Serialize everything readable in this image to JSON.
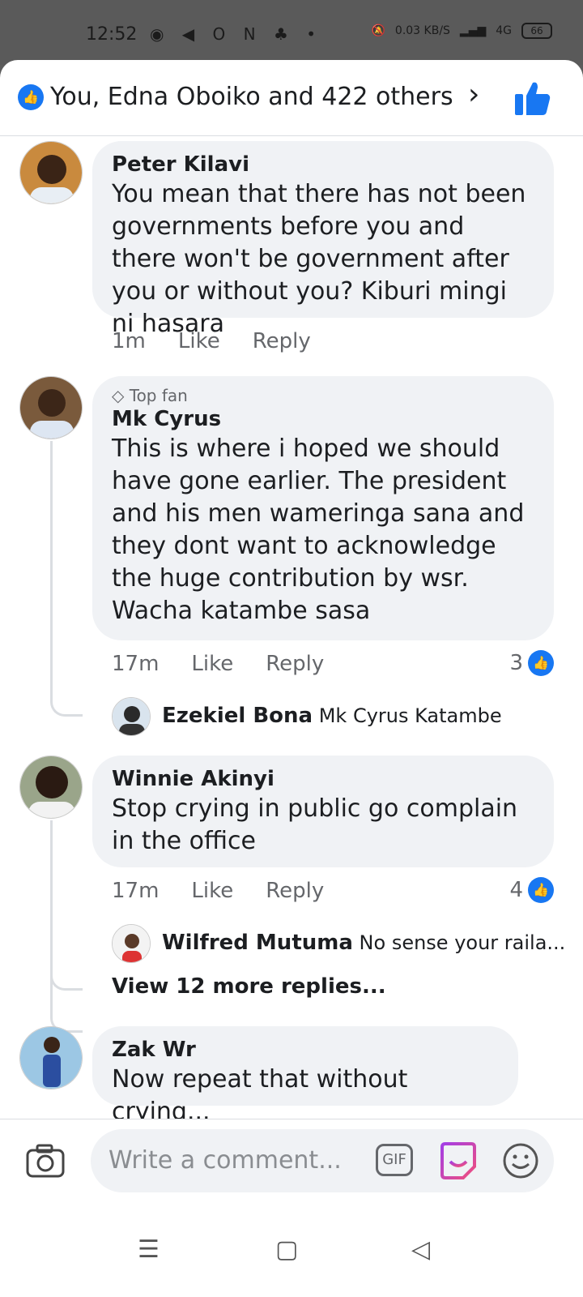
{
  "status_bar": {
    "time": "12:52",
    "app_icons": "◉ ◀ O N ♣ •",
    "network_speed": "0.03 KB/S",
    "network_type": "4G",
    "battery": "66"
  },
  "reactions": {
    "summary": "You, Edna Oboiko and 422 others",
    "accent_color": "#1877f2"
  },
  "comments": [
    {
      "author": "Peter Kilavi",
      "badge": "",
      "text": "You mean that there has not been governments before you and there won't be government after you or without you? Kiburi mingi ni hasara",
      "time": "1m",
      "like_label": "Like",
      "reply_label": "Reply",
      "like_count": ""
    },
    {
      "author": "Mk Cyrus",
      "badge": "Top fan",
      "text": "This is where i hoped we should have gone earlier. The president and his men wameringa sana and they dont want to acknowledge the huge contribution by wsr. Wacha katambe sasa",
      "time": "17m",
      "like_label": "Like",
      "reply_label": "Reply",
      "like_count": "3",
      "reply_preview": {
        "author": "Ezekiel Bona",
        "text": "Mk Cyrus Katambe"
      }
    },
    {
      "author": "Winnie Akinyi",
      "badge": "",
      "text": "Stop crying in public go complain in the office",
      "time": "17m",
      "like_label": "Like",
      "reply_label": "Reply",
      "like_count": "4",
      "reply_preview": {
        "author": "Wilfred Mutuma",
        "text": "No sense your  raila..."
      },
      "view_more": "View 12 more replies..."
    },
    {
      "author": "Zak Wr",
      "badge": "",
      "text": "Now repeat that without crying..."
    }
  ],
  "composer": {
    "placeholder": "Write a comment...",
    "gif_label": "GIF"
  }
}
